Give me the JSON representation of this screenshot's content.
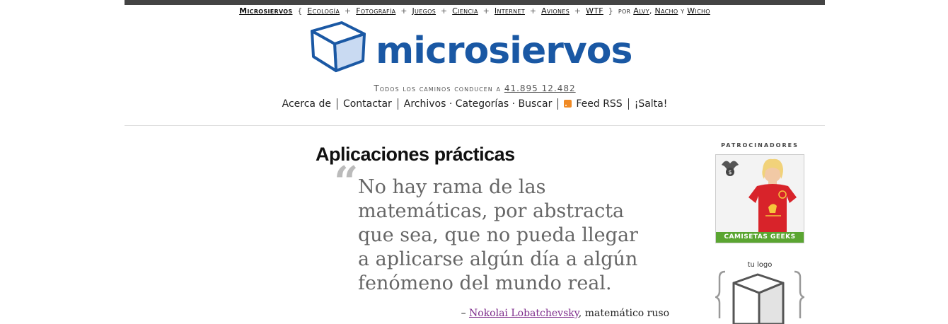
{
  "header": {
    "brand": "Microsiervos",
    "open_brace": "{",
    "close_brace": "}",
    "plus": "+",
    "categories": [
      "Ecología",
      "Fotografía",
      "Juegos",
      "Ciencia",
      "Internet",
      "Aviones",
      "WTF"
    ],
    "by_label": "por",
    "authors": [
      "Alvy",
      "Nacho",
      "Wicho"
    ],
    "author_sep1": ",",
    "author_sep2": "y"
  },
  "logo": {
    "wordmark": "microsiervos"
  },
  "tagline": {
    "text": "Todos los caminos conducen a ",
    "coords": "41.895 12.482"
  },
  "nav": {
    "about": "Acerca de",
    "contact": "Contactar",
    "archives": "Archivos · Categorías · Buscar",
    "feed": "Feed RSS",
    "jump": "¡Salta!"
  },
  "post": {
    "title": "Aplicaciones prácticas",
    "quote_mark": "“",
    "quote": "No hay rama de las matemáticas, por abstracta que sea, que no pueda llegar a aplicarse algún día a algún fenómeno del mundo real.",
    "attribution_dash": "– ",
    "attribution_author": "Nokolai Lobatchevsky",
    "attribution_rest": ", matemático ruso"
  },
  "sidebar": {
    "sponsors_label": "PATROCINADORES",
    "ad_banner": "CAMISETAS GEEKS",
    "your_logo_label": "tu logo"
  },
  "colors": {
    "brand_blue": "#1a58a4",
    "link_visited": "#7d2b8b",
    "rss_orange": "#f08a24",
    "ad_green": "#5aa531"
  }
}
